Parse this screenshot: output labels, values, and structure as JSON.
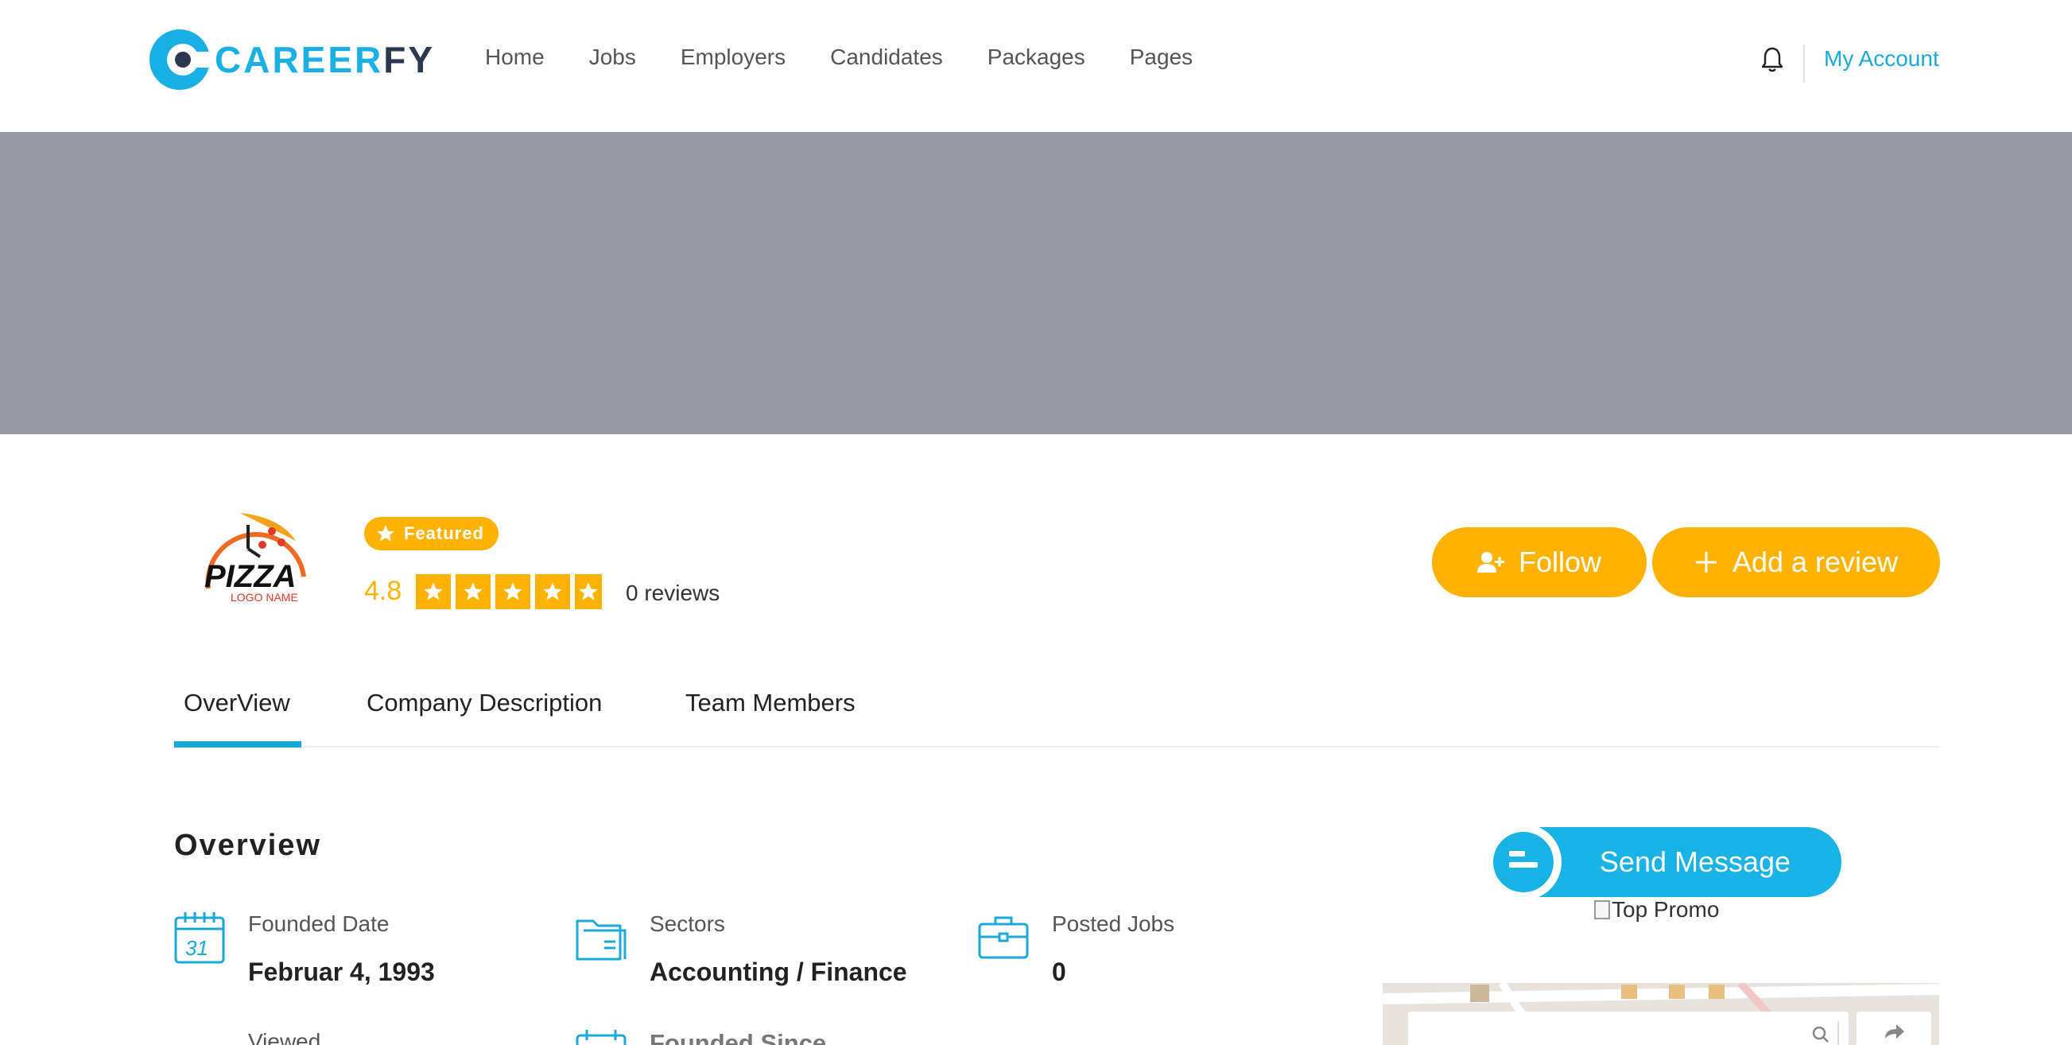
{
  "header": {
    "logo": {
      "part1": "CAREER",
      "part2": "FY"
    },
    "nav": [
      "Home",
      "Jobs",
      "Employers",
      "Candidates",
      "Packages",
      "Pages"
    ],
    "account_label": "My Account"
  },
  "company": {
    "logo_text": "PIZZA",
    "logo_subtext": "LOGO NAME",
    "featured_label": "Featured",
    "rating": "4.8",
    "rating_value": 4.8,
    "rating_max": 5,
    "reviews_label": "0 reviews"
  },
  "actions": {
    "follow_label": "Follow",
    "review_label": "Add a review"
  },
  "tabs": [
    "OverView",
    "Company Description",
    "Team Members"
  ],
  "overview": {
    "title": "Overview",
    "items": [
      {
        "label": "Founded Date",
        "value": "Februar 4, 1993",
        "icon": "calendar-icon",
        "calendar_day": "31"
      },
      {
        "label": "Sectors",
        "value": "Accounting / Finance",
        "icon": "folder-icon"
      },
      {
        "label": "Posted Jobs",
        "value": "0",
        "icon": "briefcase-icon"
      },
      {
        "label": "Viewed",
        "icon": "eye-icon"
      },
      {
        "label": "Founded Since",
        "icon": "calendar-icon"
      }
    ]
  },
  "sidebar": {
    "send_message_label": "Send Message",
    "promo_alt": "Top Promo"
  },
  "colors": {
    "accent": "#1ba9d9",
    "brand_dark": "#2a3850",
    "button_yellow": "#ffb300",
    "banner_gray": "#979aa3"
  }
}
